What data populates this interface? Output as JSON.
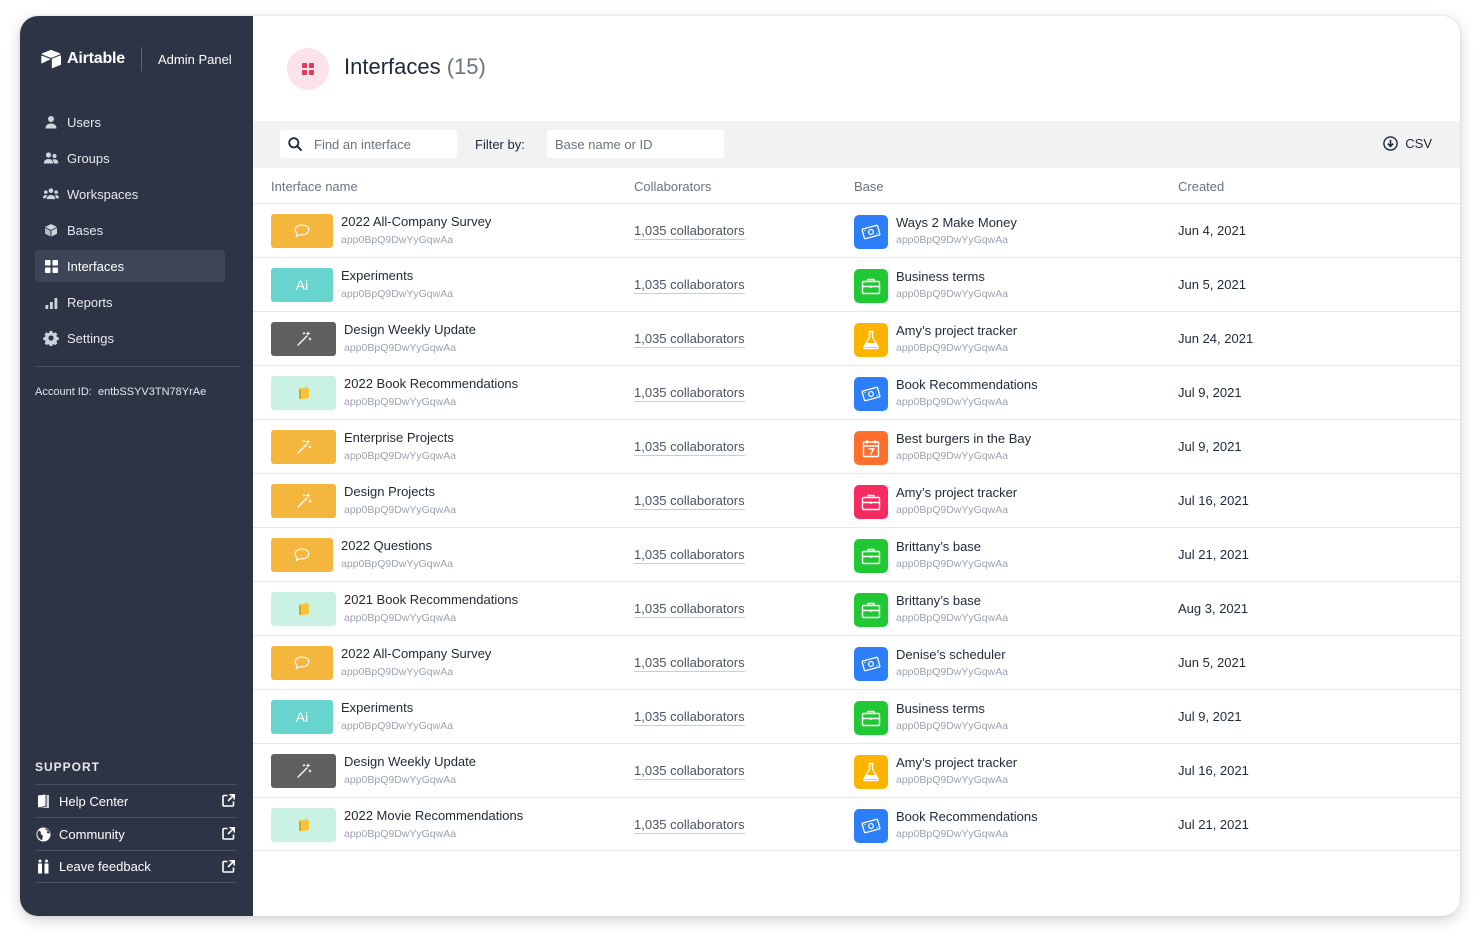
{
  "brand": {
    "name": "Airtable",
    "section": "Admin Panel"
  },
  "nav": [
    {
      "label": "Users",
      "icon": "user-icon",
      "active": false
    },
    {
      "label": "Groups",
      "icon": "group-icon",
      "active": false
    },
    {
      "label": "Workspaces",
      "icon": "workspaces-icon",
      "active": false
    },
    {
      "label": "Bases",
      "icon": "cube-icon",
      "active": false
    },
    {
      "label": "Interfaces",
      "icon": "grid-icon",
      "active": true
    },
    {
      "label": "Reports",
      "icon": "bar-chart-icon",
      "active": false
    },
    {
      "label": "Settings",
      "icon": "gear-icon",
      "active": false
    }
  ],
  "account": {
    "label": "Account ID:",
    "value": "entbSSYV3TN78YrAe"
  },
  "support": {
    "title": "SUPPORT",
    "items": [
      {
        "label": "Help Center",
        "icon": "book-icon"
      },
      {
        "label": "Community",
        "icon": "globe-icon"
      },
      {
        "label": "Leave feedback",
        "icon": "feedback-icon"
      }
    ]
  },
  "header": {
    "title": "Interfaces",
    "count": "(15)"
  },
  "toolbar": {
    "search_placeholder": "Find an interface",
    "filter_label": "Filter by:",
    "filter_placeholder": "Base name or ID",
    "csv_label": "CSV"
  },
  "columns": {
    "name": "Interface name",
    "collaborators": "Collaborators",
    "base": "Base",
    "created": "Created"
  },
  "colors": {
    "sidebar": "#2d3446",
    "accent_pink": "#e8375d"
  },
  "rows": [
    {
      "name": "2022 All-Company Survey",
      "id": "app0BpQ9DwYyGqwAa",
      "thumb": "yellow",
      "thumb_icon": "comment",
      "collaborators": "1,035 collaborators",
      "base": "Ways 2 Make Money",
      "base_id": "app0BpQ9DwYyGqwAa",
      "base_color": "blue",
      "base_icon": "money",
      "created": "Jun 4, 2021"
    },
    {
      "name": "Experiments",
      "id": "app0BpQ9DwYyGqwAa",
      "thumb": "teal",
      "thumb_icon": "ai",
      "thumb_text": "Ai",
      "collaborators": "1,035 collaborators",
      "base": "Business terms",
      "base_id": "app0BpQ9DwYyGqwAa",
      "base_color": "green",
      "base_icon": "briefcase",
      "created": "Jun 5, 2021"
    },
    {
      "name": "Design Weekly Update",
      "id": "app0BpQ9DwYyGqwAa",
      "thumb": "gray",
      "thumb_icon": "wand",
      "collaborators": "1,035 collaborators",
      "base": "Amy’s project tracker",
      "base_id": "app0BpQ9DwYyGqwAa",
      "base_color": "yellow",
      "base_icon": "flask",
      "created": "Jun 24, 2021"
    },
    {
      "name": "2022 Book Recommendations",
      "id": "app0BpQ9DwYyGqwAa",
      "thumb": "mint",
      "thumb_icon": "book",
      "collaborators": "1,035 collaborators",
      "base": "Book Recommendations",
      "base_id": "app0BpQ9DwYyGqwAa",
      "base_color": "blue",
      "base_icon": "money",
      "created": "Jul 9, 2021"
    },
    {
      "name": "Enterprise Projects",
      "id": "app0BpQ9DwYyGqwAa",
      "thumb": "yellow",
      "thumb_icon": "wand",
      "collaborators": "1,035 collaborators",
      "base": "Best burgers in the Bay",
      "base_id": "app0BpQ9DwYyGqwAa",
      "base_color": "orange",
      "base_icon": "calendar",
      "created": "Jul 9, 2021"
    },
    {
      "name": "Design Projects",
      "id": "app0BpQ9DwYyGqwAa",
      "thumb": "yellow",
      "thumb_icon": "wand",
      "collaborators": "1,035 collaborators",
      "base": "Amy’s project tracker",
      "base_id": "app0BpQ9DwYyGqwAa",
      "base_color": "pink",
      "base_icon": "briefcase",
      "created": "Jul 16, 2021"
    },
    {
      "name": "2022 Questions",
      "id": "app0BpQ9DwYyGqwAa",
      "thumb": "yellow",
      "thumb_icon": "comment",
      "collaborators": "1,035 collaborators",
      "base": "Brittany’s base",
      "base_id": "app0BpQ9DwYyGqwAa",
      "base_color": "green",
      "base_icon": "briefcase",
      "created": "Jul 21, 2021"
    },
    {
      "name": "2021 Book Recommendations",
      "id": "app0BpQ9DwYyGqwAa",
      "thumb": "mint",
      "thumb_icon": "book",
      "collaborators": "1,035 collaborators",
      "base": "Brittany’s base",
      "base_id": "app0BpQ9DwYyGqwAa",
      "base_color": "green",
      "base_icon": "briefcase",
      "created": "Aug 3, 2021"
    },
    {
      "name": "2022 All-Company Survey",
      "id": "app0BpQ9DwYyGqwAa",
      "thumb": "yellow",
      "thumb_icon": "comment",
      "collaborators": "1,035 collaborators",
      "base": "Denise’s scheduler",
      "base_id": "app0BpQ9DwYyGqwAa",
      "base_color": "blue",
      "base_icon": "money",
      "created": "Jun 5, 2021"
    },
    {
      "name": "Experiments",
      "id": "app0BpQ9DwYyGqwAa",
      "thumb": "teal",
      "thumb_icon": "ai",
      "thumb_text": "Ai",
      "collaborators": "1,035 collaborators",
      "base": "Business terms",
      "base_id": "app0BpQ9DwYyGqwAa",
      "base_color": "green",
      "base_icon": "briefcase",
      "created": "Jul 9, 2021"
    },
    {
      "name": "Design Weekly Update",
      "id": "app0BpQ9DwYyGqwAa",
      "thumb": "gray",
      "thumb_icon": "wand",
      "collaborators": "1,035 collaborators",
      "base": "Amy’s project tracker",
      "base_id": "app0BpQ9DwYyGqwAa",
      "base_color": "yellow",
      "base_icon": "flask",
      "created": "Jul 16, 2021"
    },
    {
      "name": "2022 Movie Recommendations",
      "id": "app0BpQ9DwYyGqwAa",
      "thumb": "mint",
      "thumb_icon": "book",
      "collaborators": "1,035 collaborators",
      "base": "Book Recommendations",
      "base_id": "app0BpQ9DwYyGqwAa",
      "base_color": "blue",
      "base_icon": "money",
      "created": "Jul 21, 2021"
    }
  ]
}
